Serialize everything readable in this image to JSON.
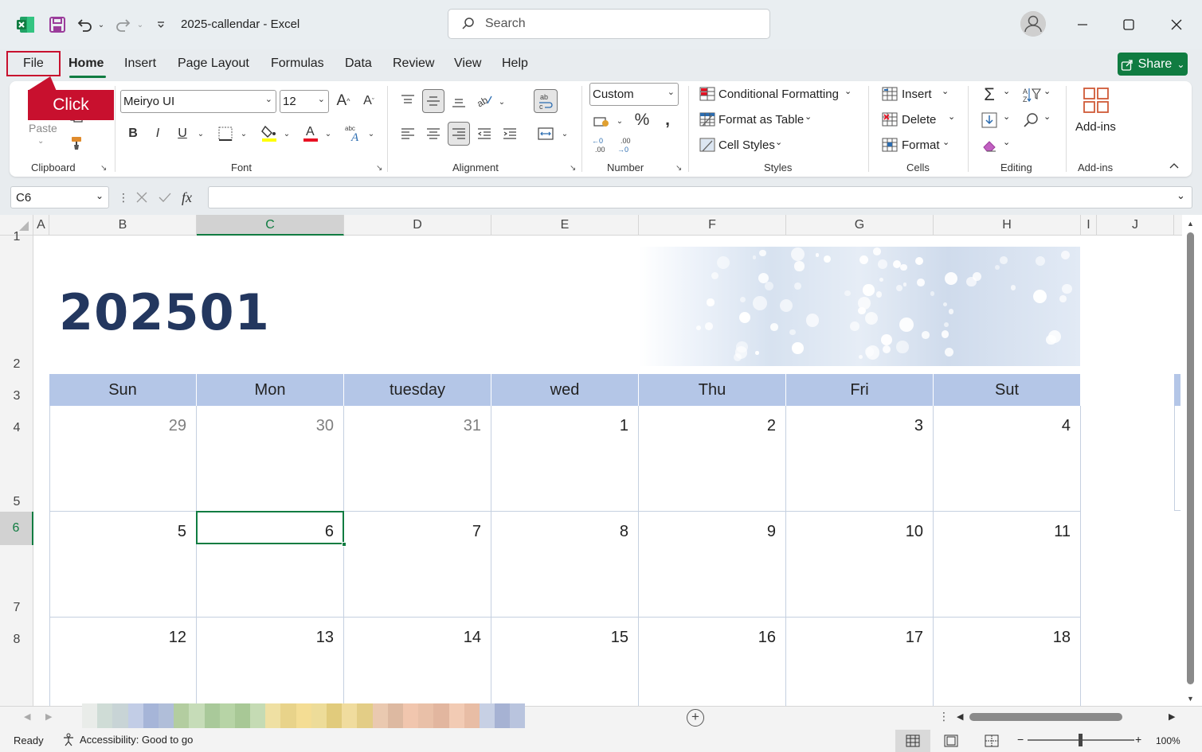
{
  "titlebar": {
    "doc_title": "2025-callendar  -  Excel",
    "search_placeholder": "Search"
  },
  "menu": {
    "file": "File",
    "home": "Home",
    "insert": "Insert",
    "page_layout": "Page Layout",
    "formulas": "Formulas",
    "data": "Data",
    "review": "Review",
    "view": "View",
    "help": "Help",
    "share": "Share"
  },
  "callout": {
    "text": "Click"
  },
  "ribbon": {
    "clipboard": {
      "label": "Clipboard",
      "paste": "Paste"
    },
    "font": {
      "label": "Font",
      "family": "Meiryo UI",
      "size": "12"
    },
    "alignment": {
      "label": "Alignment"
    },
    "number": {
      "label": "Number",
      "format": "Custom"
    },
    "styles": {
      "label": "Styles",
      "conditional": "Conditional Formatting",
      "format_table": "Format as Table",
      "cell_styles": "Cell Styles"
    },
    "cells": {
      "label": "Cells",
      "insert": "Insert",
      "delete": "Delete",
      "format": "Format"
    },
    "editing": {
      "label": "Editing"
    },
    "addins": {
      "label": "Add-ins",
      "button": "Add-ins"
    }
  },
  "formula_bar": {
    "name_box": "C6",
    "fx": "fx",
    "value": ""
  },
  "columns": [
    "A",
    "B",
    "C",
    "D",
    "E",
    "F",
    "G",
    "H",
    "I",
    "J"
  ],
  "rows": [
    "1",
    "2",
    "3",
    "4",
    "5",
    "6",
    "7",
    "8"
  ],
  "selected": {
    "column": "C",
    "row": "6"
  },
  "calendar": {
    "title": "202501",
    "weekdays": [
      "Sun",
      "Mon",
      "tuesday",
      "wed",
      "Thu",
      "Fri",
      "Sut"
    ],
    "weeks": [
      [
        "29",
        "30",
        "31",
        "1",
        "2",
        "3",
        "4"
      ],
      [
        "5",
        "6",
        "7",
        "8",
        "9",
        "10",
        "11"
      ],
      [
        "12",
        "13",
        "14",
        "15",
        "16",
        "17",
        "18"
      ]
    ],
    "prev_month_cells": 3
  },
  "sheet_tab_colors": [
    "#e9ece9",
    "#cfdcd6",
    "#c8d4d6",
    "#c2cde6",
    "#a6b5d8",
    "#b0bed9",
    "#b3cda0",
    "#c6dcb8",
    "#a9c99a",
    "#b7d4a6",
    "#a8c896",
    "#c5dbb4",
    "#efe0a3",
    "#e8d38a",
    "#f4dd94",
    "#eddc99",
    "#e1cb7c",
    "#f0dc9e",
    "#e3cd86",
    "#eac9b0",
    "#ddb9a1",
    "#f1c6ae",
    "#e9c0a8",
    "#e2b69f",
    "#f2cbb4",
    "#e8bda5",
    "#c7d0e4",
    "#a6b2d3",
    "#b9c4de"
  ],
  "statusbar": {
    "ready": "Ready",
    "accessibility": "Accessibility: Good to go",
    "zoom": "100%"
  }
}
